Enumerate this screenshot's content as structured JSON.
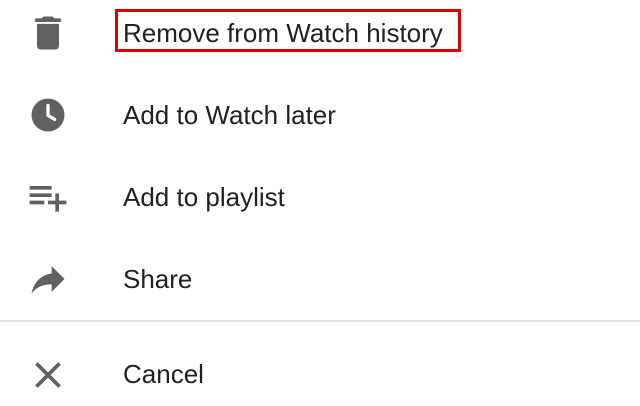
{
  "menu": {
    "items": [
      {
        "label": "Remove from Watch history",
        "icon": "trash-icon",
        "highlighted": true
      },
      {
        "label": "Add to Watch later",
        "icon": "clock-icon"
      },
      {
        "label": "Add to playlist",
        "icon": "playlist-add-icon"
      },
      {
        "label": "Share",
        "icon": "share-arrow-icon"
      }
    ],
    "cancel": {
      "label": "Cancel",
      "icon": "close-icon"
    }
  },
  "colors": {
    "icon": "#616161",
    "text": "#212121",
    "highlight": "#e00000",
    "divider": "#e0e0e0"
  }
}
